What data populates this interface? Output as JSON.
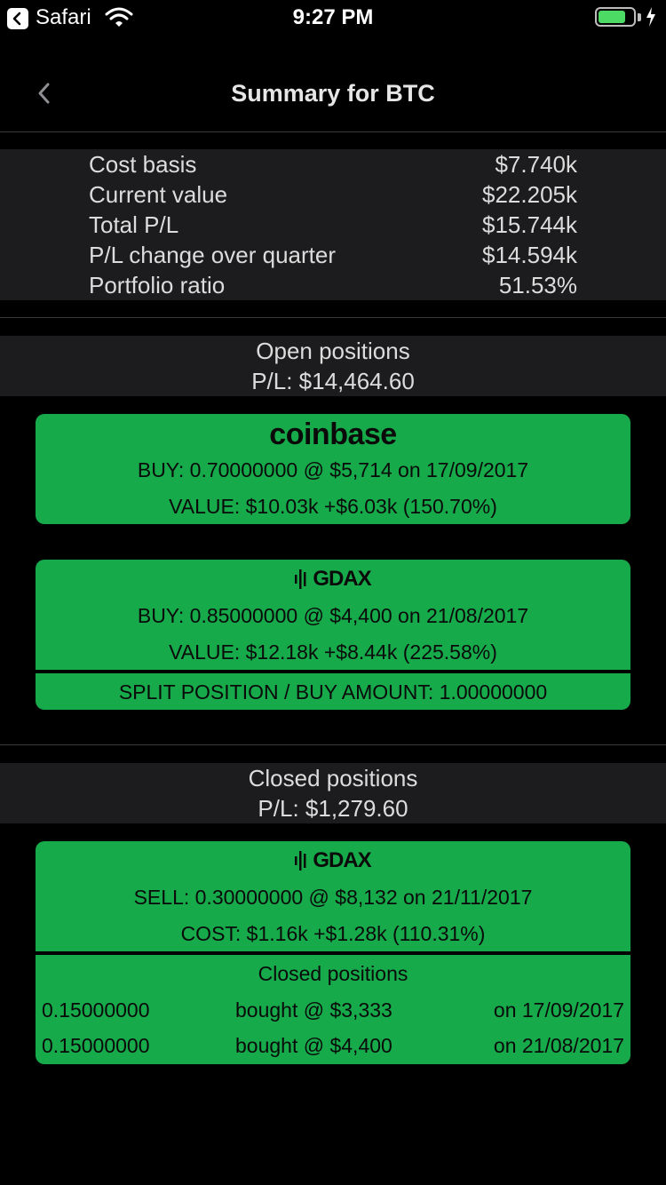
{
  "status_bar": {
    "app": "Safari",
    "time": "9:27 PM",
    "battery_level": 0.8,
    "battery_color": "#4cd964"
  },
  "nav": {
    "title": "Summary for BTC",
    "back_icon": "chevron-left-icon"
  },
  "summary": {
    "rows": [
      {
        "label": "Cost basis",
        "value": "$7.740k"
      },
      {
        "label": "Current value",
        "value": "$22.205k"
      },
      {
        "label": "Total P/L",
        "value": "$15.744k"
      },
      {
        "label": "P/L change over quarter",
        "value": "$14.594k"
      },
      {
        "label": "Portfolio ratio",
        "value": "51.53%"
      }
    ]
  },
  "open_positions": {
    "title": "Open positions",
    "pl": "P/L: $14,464.60",
    "cards": [
      {
        "exchange": "coinbase",
        "trade": "BUY: 0.70000000  @ $5,714  on 17/09/2017",
        "value": "VALUE: $10.03k  +$6.03k (150.70%)"
      },
      {
        "exchange": "GDAX",
        "trade": "BUY: 0.85000000  @ $4,400  on 21/08/2017",
        "value": "VALUE: $12.18k  +$8.44k (225.58%)",
        "split": "SPLIT POSITION / BUY AMOUNT: 1.00000000"
      }
    ]
  },
  "closed_positions": {
    "title": "Closed positions",
    "pl": "P/L: $1,279.60",
    "card": {
      "exchange": "GDAX",
      "trade": "SELL: 0.30000000  @ $8,132  on 21/11/2017",
      "cost": "COST: $1.16k  +$1.28k (110.31%)",
      "sub_title": "Closed positions",
      "rows": [
        {
          "amount": "0.15000000",
          "bought": "bought @ $3,333",
          "date": "on 17/09/2017"
        },
        {
          "amount": "0.15000000",
          "bought": "bought @ $4,400",
          "date": "on 21/08/2017"
        }
      ]
    }
  },
  "colors": {
    "card_green": "#17aa4a",
    "band_gray": "#1c1c1e",
    "background": "#000000"
  }
}
